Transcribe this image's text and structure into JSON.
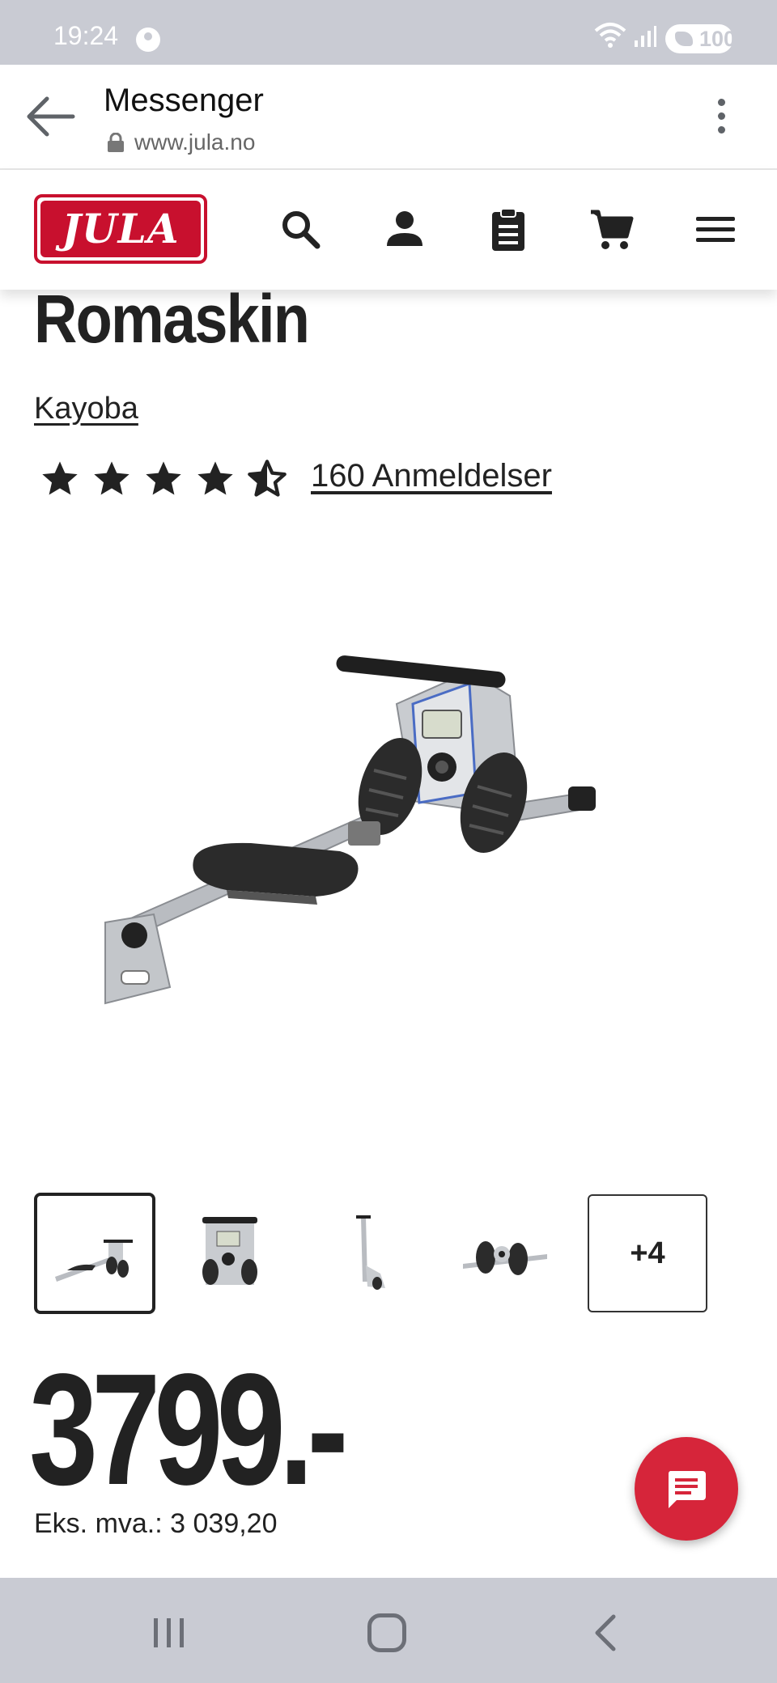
{
  "status_bar": {
    "time": "19:24",
    "battery": "100"
  },
  "browser": {
    "title": "Messenger",
    "url": "www.jula.no"
  },
  "site_header": {
    "logo_text": "JULA"
  },
  "product": {
    "title": "Romaskin",
    "brand": "Kayoba",
    "rating": 4.5,
    "rating_max": 5,
    "reviews_label": "160 Anmeldelser",
    "more_images_label": "+4",
    "price": "3799.-",
    "price_ex_vat": "Eks. mva.: 3 039,20"
  },
  "colors": {
    "brand_red": "#c8102e",
    "chat_red": "#d6253a",
    "system_bar": "#c9cbd3"
  },
  "icons": {
    "header": [
      "search-icon",
      "account-icon",
      "clipboard-icon",
      "cart-icon",
      "menu-icon"
    ],
    "chat": "chat-icon"
  }
}
